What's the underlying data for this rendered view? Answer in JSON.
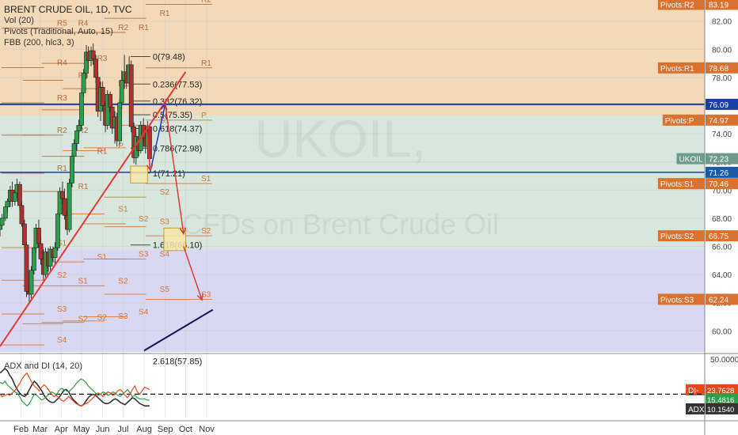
{
  "header": {
    "title": "BRENT CRUDE OIL, 1D, TVC",
    "indicators": [
      "Vol (20)",
      "Pivots (Traditional, Auto, 15)",
      "FBB (200, hlc3, 3)"
    ]
  },
  "watermark": {
    "symbol": "UKOIL,",
    "description": "CFDs on Brent Crude Oil"
  },
  "colors": {
    "zone_top": "#f3d9b8",
    "zone_mid": "#d7e7de",
    "zone_low": "#d9d8f3",
    "up_candle": "#2e9e4c",
    "down_candle": "#b03030",
    "wick": "#333333",
    "trendline": "#e53935",
    "support_line": "#0d1650",
    "blue_level": "#1a3ea8",
    "pivot_orange": "#d9722e",
    "pivot_brown": "#b36a3a",
    "fib_line": "#444444",
    "adx": "#333333",
    "di_plus": "#2e9e4c",
    "di_minus": "#e64a19",
    "forecast_red": "#e53935",
    "forecast_blue": "#1e3bbd"
  },
  "price_axis": {
    "ticks": [
      "82.00",
      "80.00",
      "78.00",
      "76.00",
      "74.00",
      "72.00",
      "70.00",
      "68.00",
      "66.00",
      "64.00",
      "62.00",
      "60.00"
    ],
    "labels": [
      {
        "text": "Pivots:R2",
        "value": "83.19",
        "price": 83.19,
        "color": "#d9722e"
      },
      {
        "text": "Pivots:R1",
        "value": "78.68",
        "price": 78.68,
        "color": "#d9722e"
      },
      {
        "text": "",
        "value": "76.09",
        "price": 76.09,
        "color": "#1a3ea8"
      },
      {
        "text": "Pivots:P",
        "value": "74.97",
        "price": 74.97,
        "color": "#d9722e"
      },
      {
        "text": "UKOIL",
        "value": "72.23",
        "price": 72.23,
        "color": "#6e9a8c"
      },
      {
        "text": "",
        "value": "71.26",
        "price": 71.26,
        "color": "#1a5aa8"
      },
      {
        "text": "Pivots:S1",
        "value": "70.46",
        "price": 70.46,
        "color": "#d9722e"
      },
      {
        "text": "Pivots:S2",
        "value": "66.75",
        "price": 66.75,
        "color": "#d9722e"
      },
      {
        "text": "Pivots:S3",
        "value": "62.24",
        "price": 62.24,
        "color": "#d9722e"
      }
    ]
  },
  "indicator_axis": {
    "ticks": [
      "50.0000"
    ],
    "labels": [
      {
        "text": "DI-",
        "value": "23.7628",
        "color": "#e64a19"
      },
      {
        "text": "",
        "value": "15.4816",
        "color": "#2e9e4c"
      },
      {
        "text": "ADX",
        "value": "10.1540",
        "color": "#333333"
      }
    ]
  },
  "time_axis": {
    "labels": [
      "Feb",
      "Mar",
      "Apr",
      "May",
      "Jun",
      "Jul",
      "Aug",
      "Sep",
      "Oct",
      "Nov"
    ]
  },
  "fib": {
    "labels": [
      "0(79.48)",
      "0.236(77.53)",
      "0.382(76.32)",
      "0.5(75.35)",
      "0.618(74.37)",
      "0.786(72.98)",
      "1(71.21)",
      "1.618(66.10)",
      "2.618(57.85)"
    ],
    "prices": [
      79.48,
      77.53,
      76.32,
      75.35,
      74.37,
      72.98,
      71.21,
      66.1,
      57.85
    ]
  },
  "adx_panel": {
    "title": "ADX and DI (14, 20)"
  },
  "chart_data": {
    "type": "candlestick",
    "title": "BRENT CRUDE OIL, 1D, TVC",
    "ylim": [
      58.5,
      83.5
    ],
    "x_range": [
      "Jan 2018",
      "Nov 2018"
    ],
    "grid": true,
    "pivot_zones": [
      {
        "name": "upper",
        "from": 75.3,
        "to": 83.5
      },
      {
        "name": "middle",
        "from": 65.8,
        "to": 75.3
      },
      {
        "name": "lower",
        "from": 58.5,
        "to": 65.8
      }
    ],
    "pivot_sets": [
      {
        "period": "Jan",
        "prices": {
          "R5": 81.5,
          "R4": 78.7,
          "R3": 76.2,
          "R2": 73.9,
          "R1": 71.2,
          "S1": 65.9,
          "S2": 63.6,
          "S3": 61.2,
          "S4": 59.0
        }
      },
      {
        "period": "Feb",
        "prices": {
          "R4": 81.5,
          "R3": 77.8,
          "R2": 73.9,
          "R1": 69.9,
          "S1": 63.2,
          "S2": 60.5
        }
      },
      {
        "period": "Mar",
        "prices": {
          "R3": 79.0,
          "R2": 75.7,
          "R1": 72.4,
          "S1": 64.9,
          "S2": 60.6
        }
      },
      {
        "period": "Apr",
        "prices": {
          "R2": 81.2,
          "R1": 77.2,
          "P": 72.8,
          "S1": 68.3,
          "S2": 63.2,
          "S3": 60.7
        }
      },
      {
        "period": "May",
        "prices": {
          "R1": 81.2,
          "S1": 73.0,
          "S2": 67.6,
          "S3": 65.1,
          "S4": 61.0
        }
      },
      {
        "period": "Jun",
        "prices": {
          "R1": 82.2,
          "S1": 74.6,
          "S2": 69.5,
          "S3": 67.4,
          "S4": 65.1,
          "S5": 62.6
        }
      },
      {
        "period": "Aug",
        "prices": {
          "R2": 83.19,
          "R1": 78.68,
          "P": 74.97,
          "S1": 70.46,
          "S2": 66.75,
          "S3": 62.24
        }
      }
    ],
    "candles": [
      {
        "date": "2018-01-01",
        "o": 67.2,
        "h": 67.9,
        "l": 66.7,
        "c": 67.5
      },
      {
        "date": "2018-01-04",
        "o": 67.5,
        "h": 68.3,
        "l": 67.2,
        "c": 68.0
      },
      {
        "date": "2018-01-09",
        "o": 68.0,
        "h": 69.0,
        "l": 67.8,
        "c": 68.8
      },
      {
        "date": "2018-01-12",
        "o": 68.8,
        "h": 69.4,
        "l": 68.4,
        "c": 69.2
      },
      {
        "date": "2018-01-16",
        "o": 69.2,
        "h": 70.3,
        "l": 68.8,
        "c": 70.0
      },
      {
        "date": "2018-01-19",
        "o": 70.0,
        "h": 70.6,
        "l": 68.8,
        "c": 69.2
      },
      {
        "date": "2018-01-23",
        "o": 69.2,
        "h": 70.1,
        "l": 68.9,
        "c": 69.8
      },
      {
        "date": "2018-01-26",
        "o": 69.8,
        "h": 70.8,
        "l": 69.4,
        "c": 70.4
      },
      {
        "date": "2018-01-30",
        "o": 70.4,
        "h": 70.6,
        "l": 68.6,
        "c": 68.9
      },
      {
        "date": "2018-02-02",
        "o": 68.9,
        "h": 69.2,
        "l": 67.4,
        "c": 67.6
      },
      {
        "date": "2018-02-06",
        "o": 67.6,
        "h": 67.9,
        "l": 65.8,
        "c": 66.1
      },
      {
        "date": "2018-02-09",
        "o": 66.1,
        "h": 66.3,
        "l": 62.4,
        "c": 62.8
      },
      {
        "date": "2018-02-13",
        "o": 62.8,
        "h": 63.4,
        "l": 61.9,
        "c": 62.6
      },
      {
        "date": "2018-02-16",
        "o": 62.6,
        "h": 64.6,
        "l": 62.3,
        "c": 64.3
      },
      {
        "date": "2018-02-20",
        "o": 64.3,
        "h": 66.2,
        "l": 64.0,
        "c": 65.9
      },
      {
        "date": "2018-02-23",
        "o": 65.9,
        "h": 67.6,
        "l": 65.5,
        "c": 67.3
      },
      {
        "date": "2018-02-27",
        "o": 67.3,
        "h": 67.9,
        "l": 65.9,
        "c": 66.2
      },
      {
        "date": "2018-03-02",
        "o": 66.2,
        "h": 66.7,
        "l": 64.7,
        "c": 65.1
      },
      {
        "date": "2018-03-06",
        "o": 65.1,
        "h": 65.8,
        "l": 63.6,
        "c": 64.0
      },
      {
        "date": "2018-03-09",
        "o": 64.0,
        "h": 65.9,
        "l": 63.8,
        "c": 65.6
      },
      {
        "date": "2018-03-13",
        "o": 65.6,
        "h": 65.9,
        "l": 64.2,
        "c": 64.6
      },
      {
        "date": "2018-03-16",
        "o": 64.6,
        "h": 66.0,
        "l": 64.3,
        "c": 65.8
      },
      {
        "date": "2018-03-20",
        "o": 65.8,
        "h": 66.0,
        "l": 64.9,
        "c": 65.2
      },
      {
        "date": "2018-03-23",
        "o": 65.2,
        "h": 66.3,
        "l": 64.6,
        "c": 65.9
      },
      {
        "date": "2018-03-27",
        "o": 65.9,
        "h": 68.6,
        "l": 65.7,
        "c": 68.3
      },
      {
        "date": "2018-03-30",
        "o": 68.3,
        "h": 70.2,
        "l": 68.1,
        "c": 69.9
      },
      {
        "date": "2018-04-03",
        "o": 69.9,
        "h": 70.6,
        "l": 69.0,
        "c": 69.4
      },
      {
        "date": "2018-04-06",
        "o": 69.4,
        "h": 70.1,
        "l": 67.9,
        "c": 68.2
      },
      {
        "date": "2018-04-10",
        "o": 68.2,
        "h": 68.6,
        "l": 66.8,
        "c": 67.2
      },
      {
        "date": "2018-04-13",
        "o": 67.2,
        "h": 70.8,
        "l": 67.0,
        "c": 70.5
      },
      {
        "date": "2018-04-17",
        "o": 70.5,
        "h": 72.7,
        "l": 70.2,
        "c": 72.4
      },
      {
        "date": "2018-04-20",
        "o": 72.4,
        "h": 73.6,
        "l": 71.9,
        "c": 73.3
      },
      {
        "date": "2018-04-24",
        "o": 73.3,
        "h": 74.6,
        "l": 72.8,
        "c": 74.2
      },
      {
        "date": "2018-04-27",
        "o": 74.2,
        "h": 75.0,
        "l": 73.6,
        "c": 74.6
      },
      {
        "date": "2018-05-01",
        "o": 74.6,
        "h": 77.2,
        "l": 74.3,
        "c": 76.9
      },
      {
        "date": "2018-05-04",
        "o": 76.9,
        "h": 78.6,
        "l": 76.6,
        "c": 78.3
      },
      {
        "date": "2018-05-08",
        "o": 78.3,
        "h": 80.3,
        "l": 77.9,
        "c": 79.8
      },
      {
        "date": "2018-05-11",
        "o": 79.8,
        "h": 80.2,
        "l": 78.6,
        "c": 79.2
      },
      {
        "date": "2018-05-15",
        "o": 79.2,
        "h": 80.2,
        "l": 78.8,
        "c": 79.9
      },
      {
        "date": "2018-05-18",
        "o": 79.9,
        "h": 80.4,
        "l": 78.9,
        "c": 79.3
      },
      {
        "date": "2018-05-22",
        "o": 79.3,
        "h": 79.6,
        "l": 77.6,
        "c": 78.0
      },
      {
        "date": "2018-05-25",
        "o": 78.0,
        "h": 78.4,
        "l": 75.2,
        "c": 75.6
      },
      {
        "date": "2018-05-29",
        "o": 75.6,
        "h": 77.7,
        "l": 74.9,
        "c": 77.3
      },
      {
        "date": "2018-06-01",
        "o": 77.3,
        "h": 77.7,
        "l": 75.6,
        "c": 76.0
      },
      {
        "date": "2018-06-05",
        "o": 76.0,
        "h": 76.3,
        "l": 74.1,
        "c": 74.6
      },
      {
        "date": "2018-06-08",
        "o": 74.6,
        "h": 77.1,
        "l": 74.3,
        "c": 76.8
      },
      {
        "date": "2018-06-12",
        "o": 76.8,
        "h": 77.0,
        "l": 75.5,
        "c": 75.9
      },
      {
        "date": "2018-06-15",
        "o": 75.9,
        "h": 76.1,
        "l": 74.0,
        "c": 74.4
      },
      {
        "date": "2018-06-19",
        "o": 74.4,
        "h": 75.6,
        "l": 73.3,
        "c": 75.2
      },
      {
        "date": "2018-06-22",
        "o": 75.2,
        "h": 75.5,
        "l": 73.1,
        "c": 73.5
      },
      {
        "date": "2018-06-26",
        "o": 73.5,
        "h": 76.5,
        "l": 73.2,
        "c": 76.2
      },
      {
        "date": "2018-06-29",
        "o": 76.2,
        "h": 78.5,
        "l": 75.8,
        "c": 77.8
      },
      {
        "date": "2018-07-03",
        "o": 77.8,
        "h": 79.6,
        "l": 77.2,
        "c": 78.4
      },
      {
        "date": "2018-07-06",
        "o": 78.4,
        "h": 78.9,
        "l": 77.2,
        "c": 77.6
      },
      {
        "date": "2018-07-10",
        "o": 77.6,
        "h": 79.5,
        "l": 77.3,
        "c": 78.9
      },
      {
        "date": "2018-07-13",
        "o": 78.9,
        "h": 79.2,
        "l": 74.1,
        "c": 74.5
      },
      {
        "date": "2018-07-17",
        "o": 74.5,
        "h": 74.8,
        "l": 71.9,
        "c": 72.3
      },
      {
        "date": "2018-07-20",
        "o": 72.3,
        "h": 74.2,
        "l": 71.8,
        "c": 73.8
      },
      {
        "date": "2018-07-24",
        "o": 73.8,
        "h": 74.6,
        "l": 72.4,
        "c": 72.8
      },
      {
        "date": "2018-07-27",
        "o": 72.8,
        "h": 74.9,
        "l": 72.6,
        "c": 74.6
      },
      {
        "date": "2018-07-31",
        "o": 74.6,
        "h": 75.1,
        "l": 73.4,
        "c": 73.7
      },
      {
        "date": "2018-08-03",
        "o": 73.7,
        "h": 74.4,
        "l": 72.6,
        "c": 73.1
      },
      {
        "date": "2018-08-06",
        "o": 73.1,
        "h": 74.9,
        "l": 72.8,
        "c": 74.5
      },
      {
        "date": "2018-08-09",
        "o": 74.5,
        "h": 74.7,
        "l": 71.6,
        "c": 72.23
      }
    ],
    "trendlines": [
      {
        "name": "rising-trendline",
        "points": [
          [
            "2018-01-01",
            58.9
          ],
          [
            "2018-10-01",
            78.4
          ]
        ]
      },
      {
        "name": "support-line",
        "points": [
          [
            "2018-08-01",
            58.6
          ],
          [
            "2018-11-10",
            61.5
          ]
        ]
      }
    ],
    "horizontal_lines": [
      76.09,
      71.26
    ],
    "forecast_path": [
      {
        "date": "2018-08-10",
        "price": 71.3,
        "color": "blue"
      },
      {
        "date": "2018-09-01",
        "price": 76.1,
        "color": "red"
      },
      {
        "date": "2018-09-28",
        "price": 66.9,
        "color": "red"
      },
      {
        "date": "2018-09-28",
        "price": 66.0,
        "color": "red"
      },
      {
        "date": "2018-10-25",
        "price": 62.2,
        "color": "red"
      }
    ],
    "target_boxes": [
      {
        "date_from": "2018-07-12",
        "date_to": "2018-08-06",
        "low": 70.5,
        "high": 71.7
      },
      {
        "date_from": "2018-08-30",
        "date_to": "2018-10-01",
        "low": 65.7,
        "high": 67.3
      }
    ],
    "adx": {
      "name": "ADX and DI (14, 20)",
      "threshold": 20,
      "series": [
        {
          "name": "ADX",
          "values": [
            38,
            40,
            42,
            40,
            36,
            33,
            28,
            24,
            21,
            19,
            18,
            20,
            24,
            28,
            31,
            29,
            26,
            23,
            19,
            16,
            14,
            13,
            13,
            15,
            17,
            20,
            23,
            24,
            22,
            18,
            15,
            13,
            11,
            10,
            11,
            14,
            17,
            19,
            20,
            19,
            17,
            15,
            13,
            12,
            12,
            13,
            15,
            16,
            15,
            13,
            12,
            11,
            13,
            15,
            17,
            16,
            14,
            12,
            11,
            10,
            10,
            10
          ]
        },
        {
          "name": "DI+",
          "values": [
            30,
            29,
            31,
            28,
            26,
            24,
            22,
            21,
            18,
            14,
            12,
            10,
            12,
            16,
            20,
            19,
            17,
            15,
            16,
            18,
            20,
            22,
            21,
            19,
            23,
            25,
            24,
            23,
            22,
            24,
            26,
            29,
            31,
            33,
            32,
            30,
            27,
            25,
            23,
            21,
            19,
            20,
            22,
            21,
            19,
            20,
            22,
            21,
            19,
            18,
            20,
            22,
            24,
            21,
            18,
            19,
            17,
            16,
            16,
            16,
            15,
            15
          ]
        },
        {
          "name": "DI-",
          "values": [
            20,
            18,
            19,
            20,
            19,
            21,
            23,
            26,
            29,
            33,
            36,
            38,
            34,
            30,
            27,
            25,
            23,
            26,
            28,
            26,
            23,
            20,
            18,
            19,
            17,
            15,
            14,
            16,
            18,
            16,
            14,
            12,
            11,
            10,
            11,
            12,
            13,
            15,
            17,
            19,
            21,
            20,
            18,
            20,
            22,
            21,
            19,
            20,
            23,
            24,
            22,
            19,
            17,
            20,
            24,
            27,
            22,
            20,
            23,
            26,
            25,
            24
          ]
        }
      ],
      "ylim": [
        0,
        52
      ]
    }
  }
}
